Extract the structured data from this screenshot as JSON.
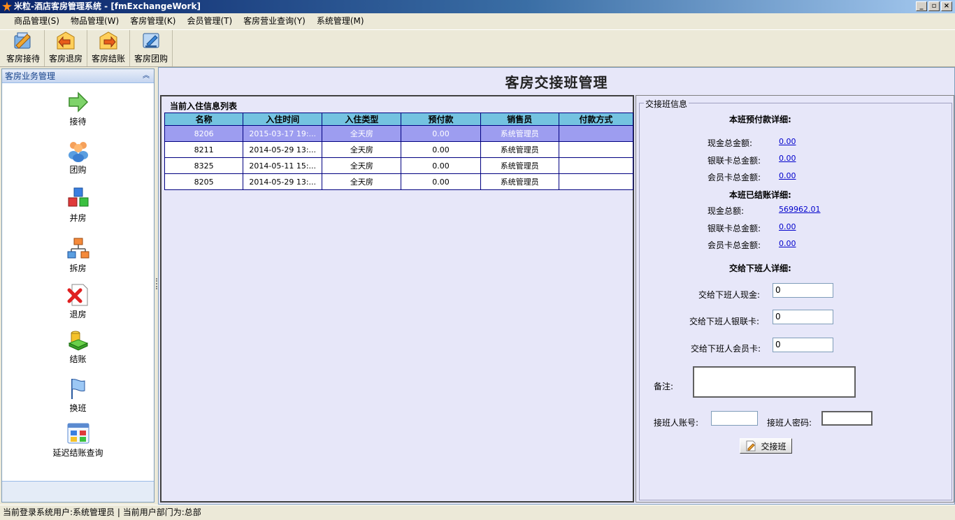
{
  "window": {
    "title": "米粒-酒店客房管理系统 - [fmExchangeWork]",
    "buttons": [
      "_",
      "▫",
      "×"
    ]
  },
  "menu": [
    "商品管理(S)",
    "物品管理(W)",
    "客房管理(K)",
    "会员管理(T)",
    "客房营业查询(Y)",
    "系统管理(M)"
  ],
  "toolbar": [
    {
      "label": "客房接待",
      "icon": "checkin-icon"
    },
    {
      "label": "客房退房",
      "icon": "checkout-icon"
    },
    {
      "label": "客房结账",
      "icon": "settle-icon"
    },
    {
      "label": "客房团购",
      "icon": "group-buy-icon"
    }
  ],
  "sidebar": {
    "header": "客房业务管理",
    "collapse": "︽",
    "items": [
      {
        "label": "接待",
        "icon": "arrow-right-icon"
      },
      {
        "label": "团购",
        "icon": "people-icon"
      },
      {
        "label": "并房",
        "icon": "cubes-icon"
      },
      {
        "label": "拆房",
        "icon": "hierarchy-icon"
      },
      {
        "label": "退房",
        "icon": "delete-document-icon"
      },
      {
        "label": "结账",
        "icon": "coins-icon"
      },
      {
        "label": "换班",
        "icon": "flag-icon"
      },
      {
        "label": "延迟结账查询",
        "icon": "grid-icon"
      }
    ]
  },
  "main": {
    "title": "客房交接班管理",
    "list": {
      "title": "当前入住信息列表",
      "columns": [
        "名称",
        "入住时间",
        "入住类型",
        "预付款",
        "销售员",
        "付款方式"
      ],
      "rows": [
        {
          "name": "8206",
          "time": "2015-03-17 19:...",
          "type": "全天房",
          "prepay": "0.00",
          "seller": "系统管理员",
          "pay": "",
          "selected": true
        },
        {
          "name": "8211",
          "time": "2014-05-29 13:...",
          "type": "全天房",
          "prepay": "0.00",
          "seller": "系统管理员",
          "pay": "",
          "selected": false
        },
        {
          "name": "8325",
          "time": "2014-05-11 15:...",
          "type": "全天房",
          "prepay": "0.00",
          "seller": "系统管理员",
          "pay": "",
          "selected": false
        },
        {
          "name": "8205",
          "time": "2014-05-29 13:...",
          "type": "全天房",
          "prepay": "0.00",
          "seller": "系统管理员",
          "pay": "",
          "selected": false
        }
      ]
    },
    "info": {
      "legend": "交接班信息",
      "prepay_title": "本班预付款详细:",
      "prepay": {
        "cash_label": "现金总金额:",
        "cash": "0.00",
        "union_label": "银联卡总金额:",
        "union": "0.00",
        "member_label": "会员卡总金额:",
        "member": "0.00"
      },
      "settled_title": "本班已结账详细:",
      "settled": {
        "cash_label": "现金总额:",
        "cash": "569962.01",
        "union_label": "银联卡总金额:",
        "union": "0.00",
        "member_label": "会员卡总金额:",
        "member": "0.00"
      },
      "handover_title": "交给下班人详细:",
      "handover": {
        "cash_label": "交给下班人现金:",
        "cash": "0",
        "union_label": "交给下班人银联卡:",
        "union": "0",
        "member_label": "交给下班人会员卡:",
        "member": "0"
      },
      "remark_label": "备注:",
      "remark": "",
      "account_label": "接班人账号:",
      "account": "",
      "password_label": "接班人密码:",
      "password": "",
      "submit_label": "交接班"
    }
  },
  "status": "当前登录系统用户:系统管理员 | 当前用户部门为:总部"
}
